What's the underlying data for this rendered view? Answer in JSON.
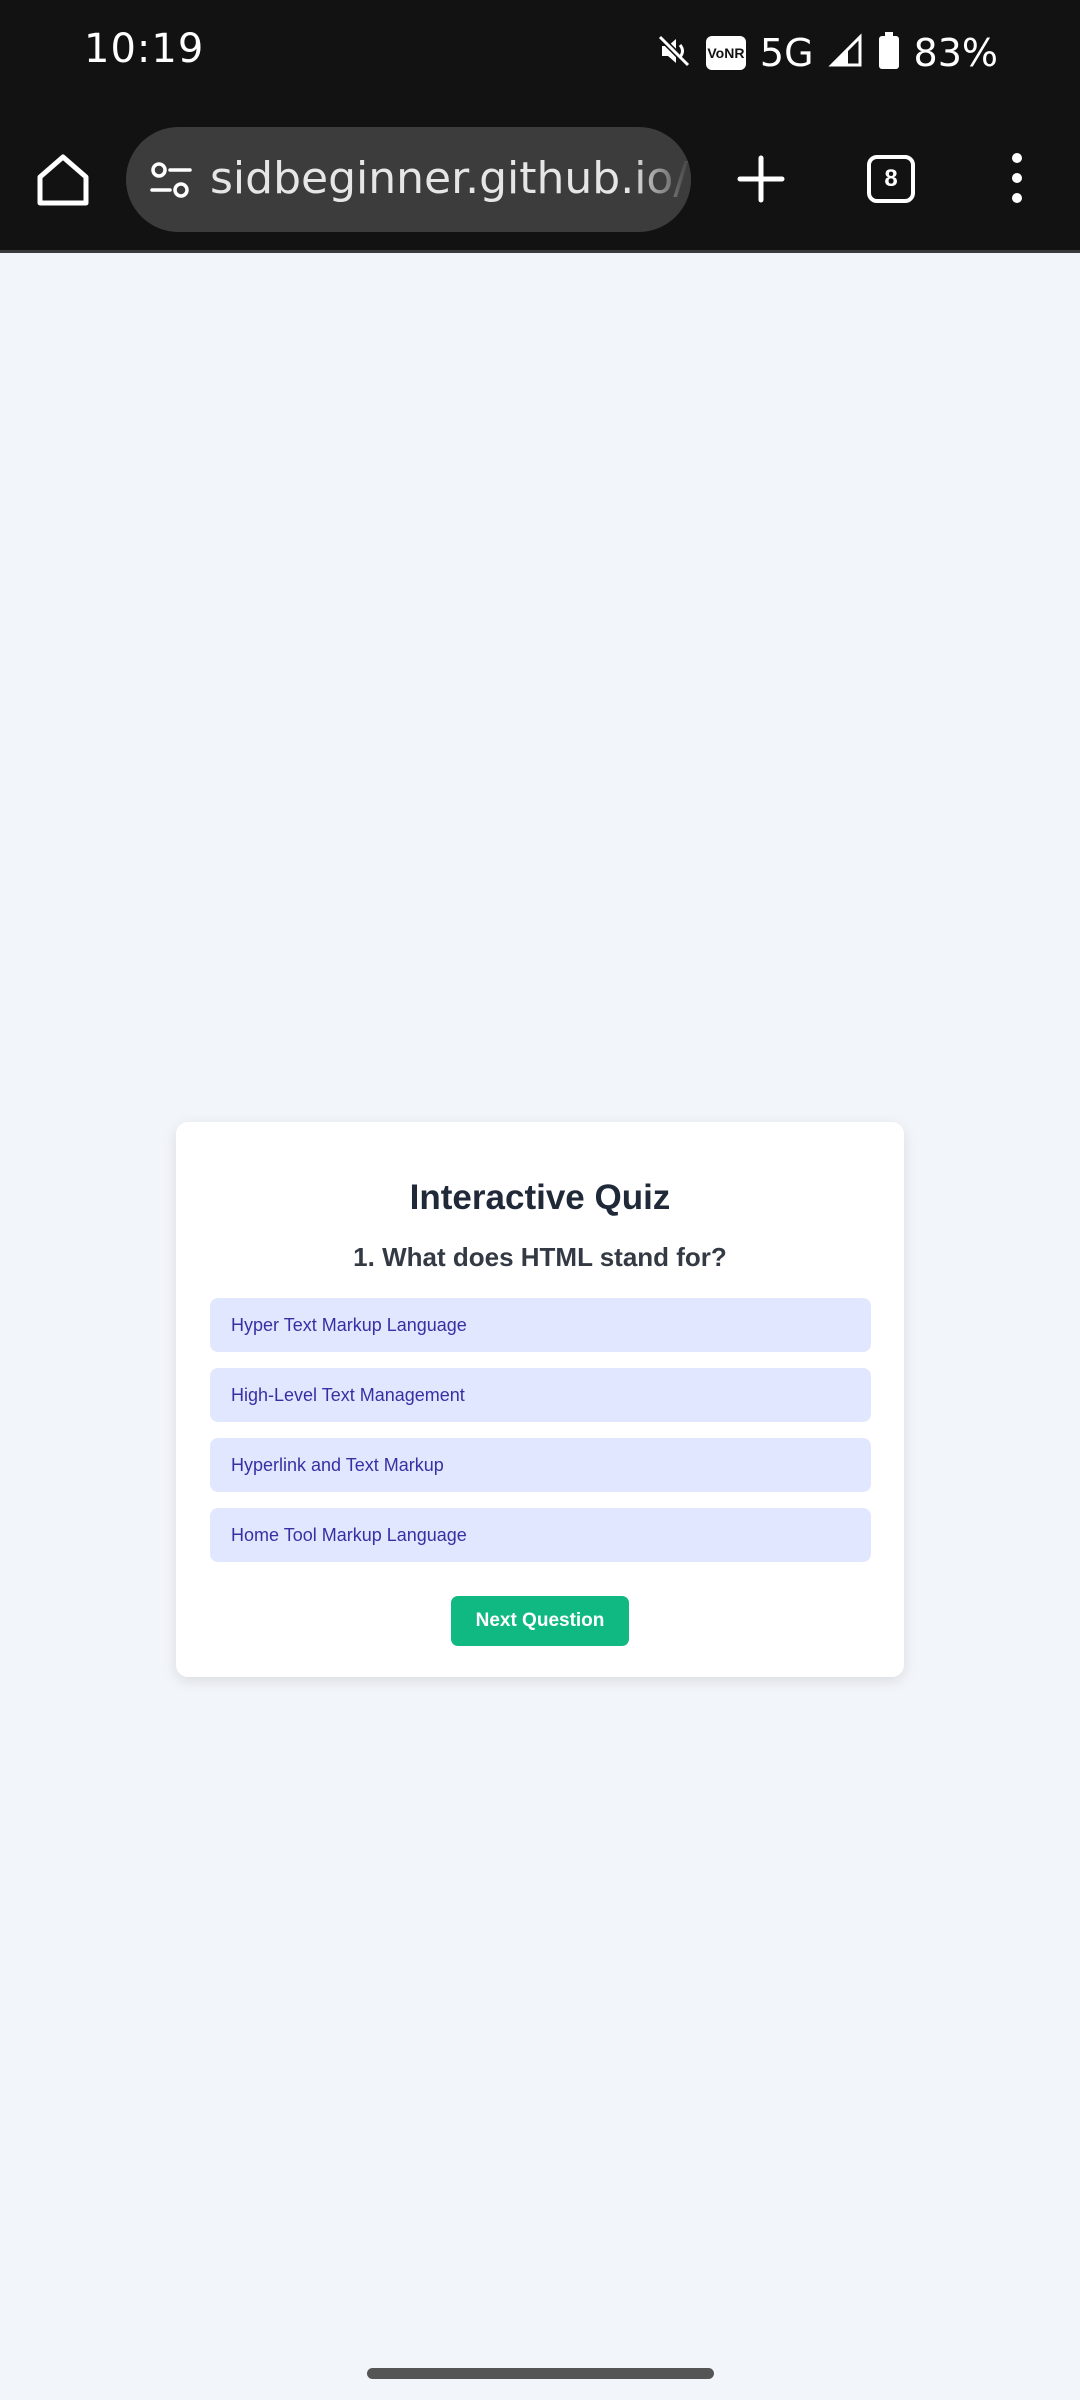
{
  "status_bar": {
    "time": "10:19",
    "network": "5G",
    "vonr_label": "VoNR",
    "battery": "83%",
    "icons": [
      "mute-icon",
      "vonr-icon",
      "signal-icon",
      "battery-icon"
    ]
  },
  "browser": {
    "url": "sidbeginner.github.io/int",
    "tab_count": "8",
    "icons": [
      "home-icon",
      "site-settings-icon",
      "new-tab-icon",
      "tab-switcher-icon",
      "more-menu-icon"
    ]
  },
  "quiz": {
    "title": "Interactive Quiz",
    "question": "1. What does HTML stand for?",
    "options": [
      "Hyper Text Markup Language",
      "High-Level Text Management",
      "Hyperlink and Text Markup",
      "Home Tool Markup Language"
    ],
    "next_label": "Next Question"
  },
  "colors": {
    "page_background": "#f2f5f9",
    "option_background": "#e0e7ff",
    "option_text": "#3730a3",
    "next_button": "#10b981",
    "title_text": "#1f2937"
  }
}
